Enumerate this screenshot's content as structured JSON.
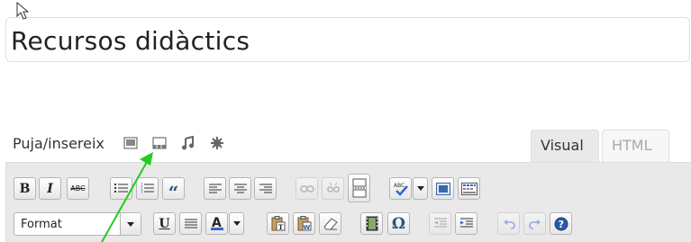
{
  "post_title": "Recursos didàctics",
  "media": {
    "label": "Puja/insereix"
  },
  "tabs": {
    "visual": "Visual",
    "html": "HTML"
  },
  "toolbar": {
    "bold": "B",
    "italic": "I",
    "strikethrough": "ABC",
    "blockquote": "“",
    "underline": "U",
    "omega": "Ω",
    "format_value": "Format"
  },
  "colors": {
    "annotation_arrow": "#22cc22",
    "toolbar_bg": "#e9e9e9"
  }
}
